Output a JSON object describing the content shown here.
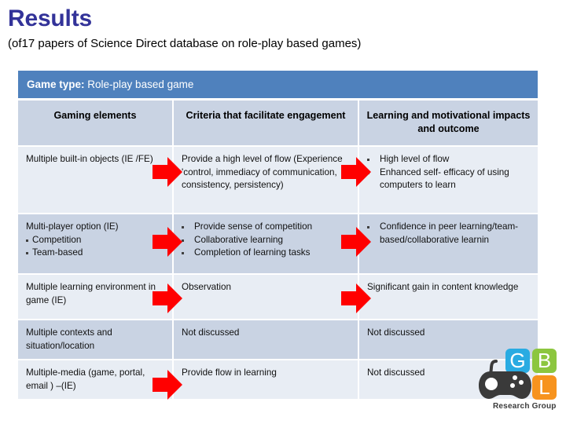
{
  "slide": {
    "title": "Results",
    "subtitle": "(of17 papers of Science Direct database on role-play based games)"
  },
  "table": {
    "band": {
      "label": "Game type:",
      "value": " Role-play based game"
    },
    "columns": [
      "Gaming elements",
      "Criteria that facilitate engagement",
      "Learning and motivational impacts and outcome"
    ],
    "rows": [
      {
        "elements_text": "Multiple built-in objects (IE /FE)",
        "criteria_text": "Provide a high level of flow (Experience 'control, immediacy of communication, consistency, persistency)",
        "impacts_bullets": [
          "High level of flow",
          "Enhanced self- efficacy of using computers to learn"
        ]
      },
      {
        "elements_text": "Multi-player option (IE)",
        "elements_bullets": [
          "Competition",
          "Team-based"
        ],
        "criteria_bullets": [
          "Provide sense of competition",
          "Collaborative learning",
          "Completion of learning tasks"
        ],
        "impacts_bullets": [
          "Confidence in peer learning/team-based/collaborative learnin"
        ]
      },
      {
        "elements_text": "Multiple learning environment  in game (IE)",
        "criteria_text": "Observation",
        "impacts_text": "Significant gain in content knowledge"
      },
      {
        "elements_text": "Multiple contexts and situation/location",
        "criteria_text": "Not discussed",
        "impacts_text": "Not discussed"
      },
      {
        "elements_text": "Multiple-media  (game, portal, email ) –(IE)",
        "criteria_text": "Provide flow in learning",
        "impacts_text": "Not discussed"
      }
    ]
  },
  "logo": {
    "tile_g": "G",
    "tile_b": "B",
    "tile_l": "L",
    "caption": "Research Group"
  },
  "colors": {
    "title": "#333399",
    "band": "#4F81BD",
    "row_light": "#E8EDF4",
    "row_dark": "#C9D3E3",
    "not_discussed": "#C0504D",
    "arrow": "#FF0000",
    "tile_g": "#29ABE2",
    "tile_b": "#8CC63F",
    "tile_l": "#F7931E"
  }
}
